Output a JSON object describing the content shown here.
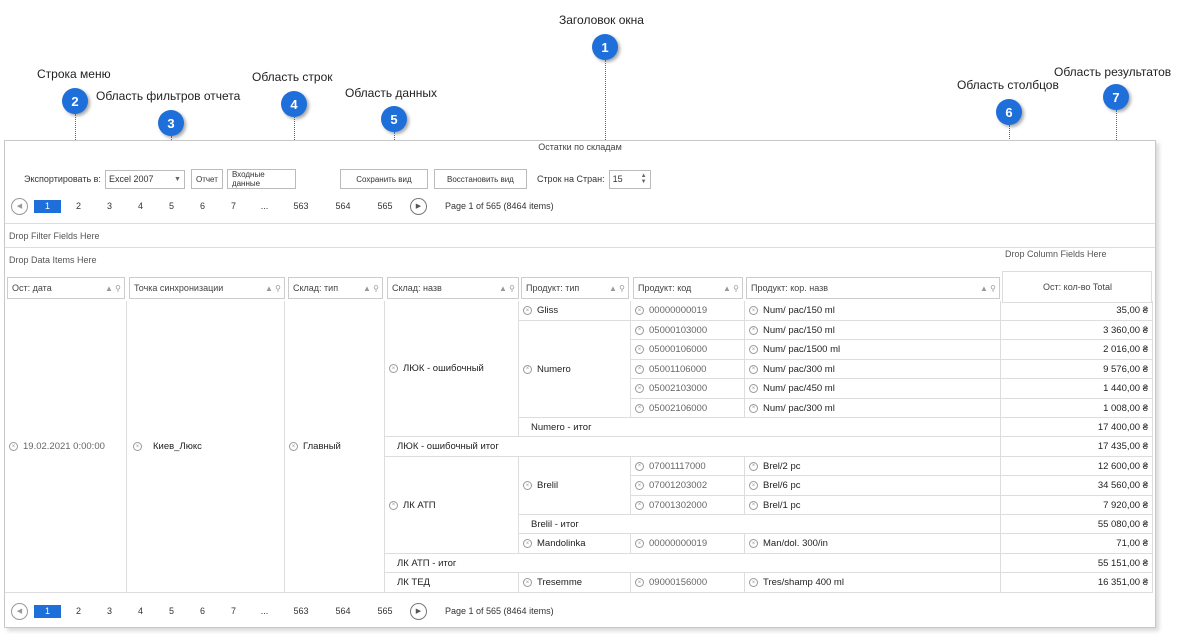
{
  "callouts": [
    {
      "n": "1",
      "label": "Заголовок окна"
    },
    {
      "n": "2",
      "label": "Строка меню"
    },
    {
      "n": "3",
      "label": "Область фильтров отчета"
    },
    {
      "n": "4",
      "label": "Область строк"
    },
    {
      "n": "5",
      "label": "Область данных"
    },
    {
      "n": "6",
      "label": "Область столбцов"
    },
    {
      "n": "7",
      "label": "Область результатов"
    }
  ],
  "window": {
    "title": "Остатки по складам"
  },
  "toolbar": {
    "export_label": "Экспортировать в:",
    "export_value": "Excel 2007",
    "report_btn": "Отчет",
    "input_btn": "Входные данные",
    "save_btn": "Сохранить вид",
    "restore_btn": "Восстановить вид",
    "rows_label": "Строк на Стран:",
    "rows_value": "15"
  },
  "pager": {
    "current": "1",
    "pages": [
      "2",
      "3",
      "4",
      "5",
      "6",
      "7",
      "...",
      "563",
      "564",
      "565"
    ],
    "summary": "Page 1 of 565 (8464 items)"
  },
  "zones": {
    "filter": "Drop Filter Fields Here",
    "data": "Drop Data Items Here",
    "column": "Drop Column Fields Here"
  },
  "headers": [
    "Ост: дата",
    "Точка синхронизации",
    "Склад: тип",
    "Склад: назв",
    "Продукт: тип",
    "Продукт: код",
    "Продукт: кор. назв",
    "Ост: кол-во Total"
  ],
  "groups": {
    "date": "19.02.2021 0:00:00",
    "point": "Киев_Люкс",
    "wtype": "Главный",
    "wh1": "ЛЮК - ошибочный",
    "wh1_total": "ЛЮК - ошибочный итог",
    "wh2": "ЛК АТП",
    "wh2_total": "ЛК АТП - итог",
    "wh3": "ЛК ТЕД",
    "p_gliss": "Gliss",
    "p_numero": "Numero",
    "p_numero_total": "Numero - итог",
    "p_brelil": "Brelil",
    "p_brelil_total": "Brelil - итог",
    "p_mandolinka": "Mandolinka",
    "p_tresemme": "Tresemme"
  },
  "rows": [
    {
      "code": "00000000019",
      "name": "Num/ pac/150 ml",
      "val": "35,00 ₴"
    },
    {
      "code": "05000103000",
      "name": "Num/ pac/150 ml",
      "val": "3 360,00 ₴"
    },
    {
      "code": "05000106000",
      "name": "Num/ pac/1500 ml",
      "val": "2 016,00 ₴"
    },
    {
      "code": "05001106000",
      "name": "Num/ pac/300 ml",
      "val": "9 576,00 ₴"
    },
    {
      "code": "05002103000",
      "name": "Num/ pac/450 ml",
      "val": "1 440,00 ₴"
    },
    {
      "code": "05002106000",
      "name": "Num/ pac/300 ml",
      "val": "1 008,00 ₴"
    },
    {
      "code": "",
      "name": "",
      "val": "17 400,00 ₴"
    },
    {
      "code": "",
      "name": "",
      "val": "17 435,00 ₴"
    },
    {
      "code": "07001117000",
      "name": "Brel/2 pc",
      "val": "12 600,00 ₴"
    },
    {
      "code": "07001203002",
      "name": "Brel/6 pc",
      "val": "34 560,00 ₴"
    },
    {
      "code": "07001302000",
      "name": "Brel/1 pc",
      "val": "7 920,00 ₴"
    },
    {
      "code": "",
      "name": "",
      "val": "55 080,00 ₴"
    },
    {
      "code": "00000000019",
      "name": "Man/dol. 300/in",
      "val": "71,00 ₴"
    },
    {
      "code": "",
      "name": "",
      "val": "55 151,00 ₴"
    },
    {
      "code": "09000156000",
      "name": "Tres/shamp 400 ml",
      "val": "16 351,00 ₴"
    }
  ]
}
